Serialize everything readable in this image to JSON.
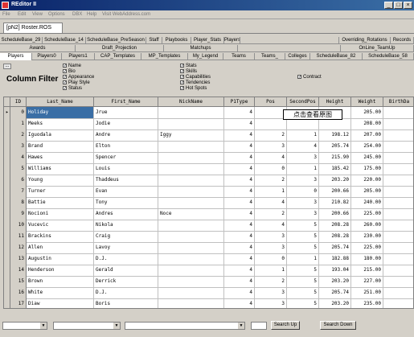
{
  "window": {
    "title": "REditor II",
    "minimize": "_",
    "maximize": "□",
    "close": "×"
  },
  "menu": [
    "File",
    "Edit",
    "View",
    "Options",
    "DBX",
    "Help",
    "Visit WebAddress.com"
  ],
  "document_tab": "[pN2] Roster.ROS",
  "tab_rows": [
    [
      "ScheduleBase_29",
      "ScheduleBase_14",
      "ScheduleBase_PreSeason",
      "Staff",
      "Playbooks",
      "Player_Stats",
      "Players",
      "",
      "Overriding_Rotations",
      "Records"
    ],
    [
      "Awards",
      "Draft_Projection",
      "Matchups",
      "",
      "OnLine_TeamUp"
    ],
    [
      "Players",
      "Players0",
      "Players1",
      "CAP_Templates",
      "MP_Templates",
      "My_Legend",
      "Teams",
      "Teams_",
      "Colleges",
      "ScheduleBase_82",
      "ScheduleBase_58"
    ]
  ],
  "filter": {
    "button": "...",
    "title": "Column Filter",
    "options": [
      {
        "label": "Name",
        "checked": true
      },
      {
        "label": "Bio",
        "checked": true
      },
      {
        "label": "Appearance",
        "checked": true
      },
      {
        "label": "Play Style",
        "checked": true
      },
      {
        "label": "Status",
        "checked": true
      },
      {
        "label": "Stats",
        "checked": true
      },
      {
        "label": "Skills",
        "checked": true
      },
      {
        "label": "Capabilities",
        "checked": true
      },
      {
        "label": "Tendencies",
        "checked": true
      },
      {
        "label": "Hot Spots",
        "checked": true
      },
      {
        "label": "Contract",
        "checked": true
      }
    ]
  },
  "grid": {
    "columns": [
      "ID",
      "Last_Name",
      "First_Name",
      "NickName",
      "P1Type",
      "Pos",
      "SecondPos",
      "Height",
      "Weight",
      "BirthDa"
    ],
    "rows": [
      {
        "id": "0",
        "last": "Holiday",
        "first": "Jrue",
        "nick": "",
        "p1type": "4",
        "pos": "",
        "second": "",
        "height": "",
        "weight": "205.00"
      },
      {
        "id": "1",
        "last": "Meeks",
        "first": "Jodie",
        "nick": "",
        "p1type": "4",
        "pos": "",
        "second": "",
        "height": "",
        "weight": "208.00"
      },
      {
        "id": "2",
        "last": "Iguodala",
        "first": "Andre",
        "nick": "Iggy",
        "p1type": "4",
        "pos": "2",
        "second": "1",
        "height": "198.12",
        "weight": "207.00"
      },
      {
        "id": "3",
        "last": "Brand",
        "first": "Elton",
        "nick": "",
        "p1type": "4",
        "pos": "3",
        "second": "4",
        "height": "205.74",
        "weight": "254.00"
      },
      {
        "id": "4",
        "last": "Hawes",
        "first": "Spencer",
        "nick": "",
        "p1type": "4",
        "pos": "4",
        "second": "3",
        "height": "215.90",
        "weight": "245.00"
      },
      {
        "id": "5",
        "last": "Williams",
        "first": "Louis",
        "nick": "",
        "p1type": "4",
        "pos": "0",
        "second": "1",
        "height": "185.42",
        "weight": "175.00"
      },
      {
        "id": "6",
        "last": "Young",
        "first": "Thaddeus",
        "nick": "",
        "p1type": "4",
        "pos": "2",
        "second": "3",
        "height": "203.20",
        "weight": "220.00"
      },
      {
        "id": "7",
        "last": "Turner",
        "first": "Evan",
        "nick": "",
        "p1type": "4",
        "pos": "1",
        "second": "0",
        "height": "200.66",
        "weight": "205.00"
      },
      {
        "id": "8",
        "last": "Battie",
        "first": "Tony",
        "nick": "",
        "p1type": "4",
        "pos": "4",
        "second": "3",
        "height": "210.82",
        "weight": "240.00"
      },
      {
        "id": "9",
        "last": "Nocioni",
        "first": "Andres",
        "nick": "Noce",
        "p1type": "4",
        "pos": "2",
        "second": "3",
        "height": "200.66",
        "weight": "225.00"
      },
      {
        "id": "10",
        "last": "Vucevic",
        "first": "Nikola",
        "nick": "",
        "p1type": "4",
        "pos": "4",
        "second": "5",
        "height": "208.28",
        "weight": "260.00"
      },
      {
        "id": "11",
        "last": "Brackins",
        "first": "Craig",
        "nick": "",
        "p1type": "4",
        "pos": "3",
        "second": "5",
        "height": "208.28",
        "weight": "230.00"
      },
      {
        "id": "12",
        "last": "Allen",
        "first": "Lavoy",
        "nick": "",
        "p1type": "4",
        "pos": "3",
        "second": "5",
        "height": "205.74",
        "weight": "225.00"
      },
      {
        "id": "13",
        "last": "Augustin",
        "first": "D.J.",
        "nick": "",
        "p1type": "4",
        "pos": "0",
        "second": "1",
        "height": "182.88",
        "weight": "180.00"
      },
      {
        "id": "14",
        "last": "Henderson",
        "first": "Gerald",
        "nick": "",
        "p1type": "4",
        "pos": "1",
        "second": "5",
        "height": "193.04",
        "weight": "215.00"
      },
      {
        "id": "15",
        "last": "Brown",
        "first": "Derrick",
        "nick": "",
        "p1type": "4",
        "pos": "2",
        "second": "5",
        "height": "203.20",
        "weight": "227.00"
      },
      {
        "id": "16",
        "last": "White",
        "first": "D.J.",
        "nick": "",
        "p1type": "4",
        "pos": "3",
        "second": "5",
        "height": "205.74",
        "weight": "251.00"
      },
      {
        "id": "17",
        "last": "Diaw",
        "first": "Boris",
        "nick": "",
        "p1type": "4",
        "pos": "3",
        "second": "5",
        "height": "203.20",
        "weight": "235.00"
      }
    ]
  },
  "tooltip": "点击查看原图",
  "bottom": {
    "search_up": "Search Up",
    "search_down": "Search Down"
  }
}
